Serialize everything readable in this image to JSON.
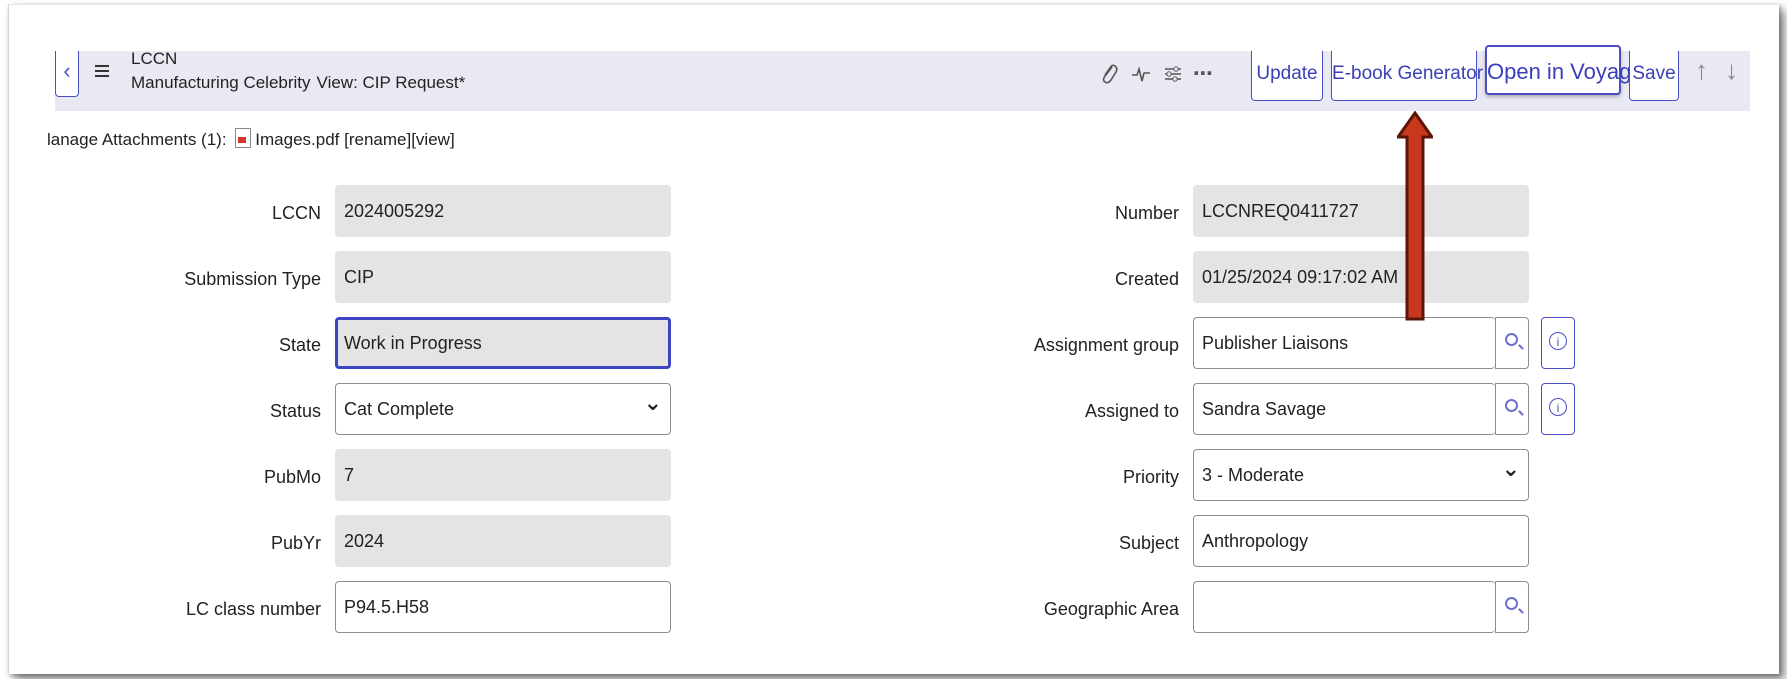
{
  "header": {
    "record_type": "LCCN",
    "record_name": "Manufacturing Celebrity",
    "view_label": "View: CIP Request*",
    "buttons": {
      "update": "Update",
      "ebook": "E-book Generator",
      "voyager": "Open in Voyager",
      "save": "Save"
    },
    "more_glyph": "⋯"
  },
  "attachments": {
    "prefix": "lanage Attachments (1):",
    "file": "Images.pdf",
    "links": "[rename][view]"
  },
  "form": {
    "left": [
      {
        "label": "LCCN",
        "value": "2024005292"
      },
      {
        "label": "Submission Type",
        "value": "CIP"
      },
      {
        "label": "State",
        "value": "Work in Progress"
      },
      {
        "label": "Status",
        "value": "Cat Complete"
      },
      {
        "label": "PubMo",
        "value": "7"
      },
      {
        "label": "PubYr",
        "value": "2024"
      },
      {
        "label": "LC class number",
        "value": "P94.5.H58"
      }
    ],
    "right": [
      {
        "label": "Number",
        "value": "LCCNREQ0411727"
      },
      {
        "label": "Created",
        "value": "01/25/2024 09:17:02 AM"
      },
      {
        "label": "Assignment group",
        "value": "Publisher Liaisons"
      },
      {
        "label": "Assigned to",
        "value": "Sandra Savage"
      },
      {
        "label": "Priority",
        "value": "3 - Moderate"
      },
      {
        "label": "Subject",
        "value": "Anthropology"
      },
      {
        "label": "Geographic Area",
        "value": ""
      }
    ]
  },
  "colors": {
    "accent": "#4a4fc4",
    "header_bg": "#e9e9f3",
    "readonly_bg": "#e4e4e4",
    "annotation_arrow": "#c8381c"
  }
}
